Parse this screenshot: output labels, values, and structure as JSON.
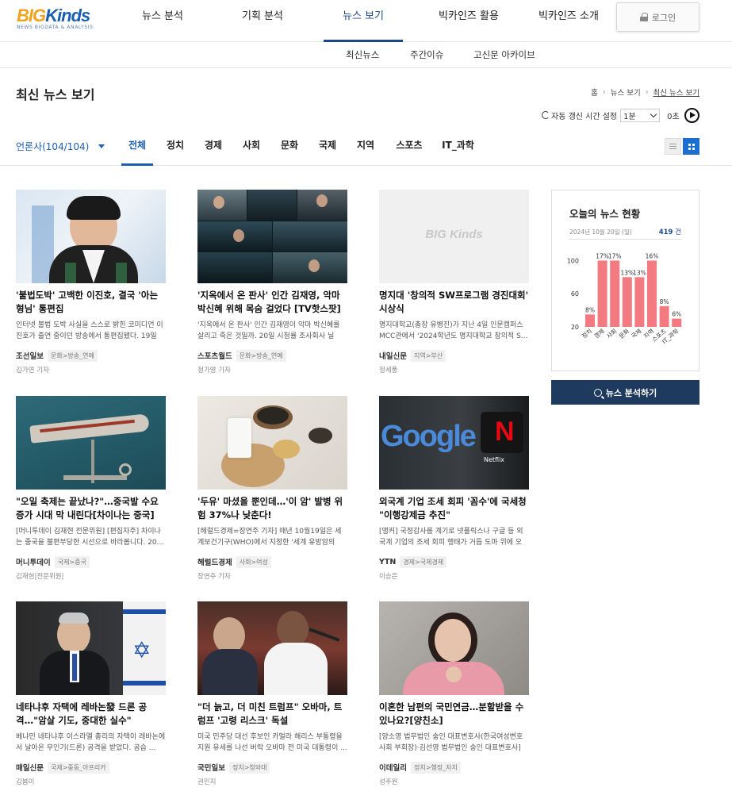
{
  "logo": {
    "text_big": "BIG",
    "text_kinds": "Kinds",
    "tagline": "NEWS BIGDATA & ANALYSIS"
  },
  "gnb": [
    {
      "label": "뉴스 분석"
    },
    {
      "label": "기획 분석"
    },
    {
      "label": "뉴스 보기"
    },
    {
      "label": "빅카인즈 활용"
    },
    {
      "label": "빅카인즈 소개"
    }
  ],
  "login_label": "로그인",
  "subnav": [
    "최신뉴스",
    "주간이슈",
    "고신문 아카이브"
  ],
  "page_title": "최신 뉴스 보기",
  "breadcrumb": [
    "홈",
    "뉴스 보기",
    "최신 뉴스 보기"
  ],
  "refresh": {
    "label": "자동 갱신 시간 설정",
    "interval": "1분",
    "seconds": "0초"
  },
  "press_filter": "언론사(104/104)",
  "tabs": [
    "전체",
    "정치",
    "경제",
    "사회",
    "문화",
    "국제",
    "지역",
    "스포츠",
    "IT_과학"
  ],
  "articles": [
    {
      "title": "'불법도박' 고백한 이진호, 결국 '아는형님' 통편집",
      "summary": "인터넷 불법 도박 사실을 스스로 밝힌 코미디언 이진호가 출연 중이던 방송에서 통편집됐다. 19일 ...",
      "press": "조선일보",
      "category": "문화>방송_연예",
      "reporter": "김가연 기자"
    },
    {
      "title": "'지옥에서 온 판사' 인간 김재영, 악마 박신혜 위해 목숨 걸었다 [TV핫스팟]",
      "summary": "'지옥에서 온 판사' 인간 김재영이 악마 박신혜를 살리고 죽은 것일까. 20일 시청률 조사회사 닐슨...",
      "press": "스포츠월드",
      "category": "문화>방송_연예",
      "reporter": "정가영 기자"
    },
    {
      "title": "명지대 '창의적 SW프로그램 경진대회' 시상식",
      "summary": "명지대학교(총장 유병진)가 지난 4일 인문캠퍼스 MCC관에서 '2024학년도 명지대학교 창의적 S...",
      "press": "내일신문",
      "category": "지역>부산",
      "reporter": "정세풍"
    },
    {
      "title": "\"오일 축제는 끝났나?\"…중국발 수요 증가 시대 막 내린다[차이나는 중국]",
      "summary": "[머니투데이 김재현 전문위원] [편집자주] 차이나는 중국을 불편부당한 시선으로 바라봅니다. 20...",
      "press": "머니투데이",
      "category": "국제>중국",
      "reporter": "김재현|전문위원|"
    },
    {
      "title": "'두유' 마셨을 뿐인데…'이 암' 발병 위험 37%나 낮춘다!",
      "summary": "[헤럴드경제=장연주 기자] 매년 10월19일은 세계보건기구(WHO)에서 지정한 '세계 유방암의 날'...",
      "press": "헤럴드경제",
      "category": "사회>여성",
      "reporter": "장연주 기자"
    },
    {
      "title": "외국계 기업 조세 회피 '꼼수'에 국세청 \"이행강제금 추진\"",
      "summary": "[앵커] 국정감사를 계기로 넷플릭스나 구글 등 외국계 기업의 조세 회피 행태가 거듭 도마 위에 오르...",
      "press": "YTN",
      "category": "경제>국제경제",
      "reporter": "이승은"
    },
    {
      "title": "네타냐후 자택에 레바논發 드론 공격…\"암살 기도, 중대한 실수\"",
      "summary": "베냐민 네타냐후 이스라엘 총리의 자택이 레바논에서 날아온 무인기(드론) 공격을 받았다. 공습 ...",
      "press": "매일신문",
      "category": "국제>중동_아프리카",
      "reporter": "김봄이"
    },
    {
      "title": "\"더 늙고, 더 미친 트럼프\" 오바마, 트럼프 '고령 리스크' 독설",
      "summary": "미국 민주당 대선 후보인 카멀라 해리스 부통령을 지원 유세를 나선 버락 오바마 전 미국 대통령이 ...",
      "press": "국민일보",
      "category": "정치>청와대",
      "reporter": "권민지"
    },
    {
      "title": "이혼한 남편의 국민연금…분할받을 수 있나요?[양친소]",
      "summary": "[양소영 법무법인 숭인 대표변호사(한국여성변호사회 부회장)·김선영 법무법인 숭인 대표변호사] ...",
      "press": "이데일리",
      "category": "정치>행정_자치",
      "reporter": "성주원"
    }
  ],
  "placeholder_logo": "BIG Kinds",
  "thumb_text": {
    "netflix": "Netflix",
    "google": "Google"
  },
  "status": {
    "title": "오늘의 뉴스 현황",
    "date": "2024년 10월 20일 (일)",
    "count": "419",
    "count_unit": "건"
  },
  "analyze_label": "뉴스 분석하기",
  "chart_data": {
    "type": "bar",
    "categories": [
      "정치",
      "경제",
      "사회",
      "문화",
      "국제",
      "지역",
      "스포츠",
      "IT_과학"
    ],
    "values": [
      35,
      100,
      100,
      80,
      80,
      100,
      45,
      30
    ],
    "data_labels": [
      "8%",
      "17%",
      "17%",
      "13%",
      "13%",
      "16%",
      "8%",
      "6%"
    ],
    "ytick_labels": [
      "100",
      "60",
      "20"
    ],
    "ylim": [
      20,
      110
    ],
    "bar_color": "#f47a82"
  },
  "colors": {
    "accent": "#1b5fb4",
    "nav_active": "#1b4a8c",
    "button_dark": "#1e3a5f"
  }
}
